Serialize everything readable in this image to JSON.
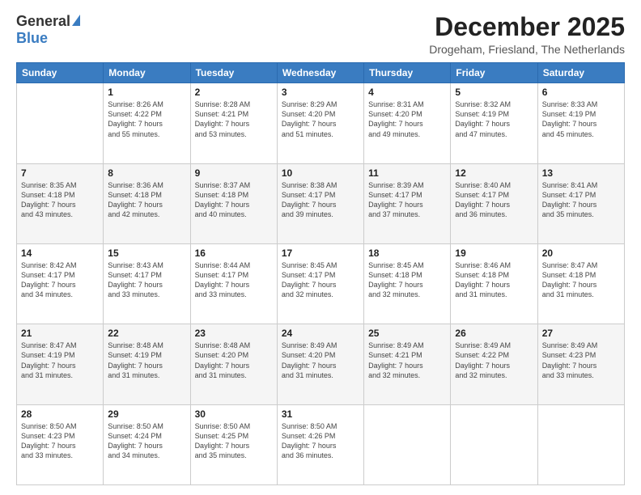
{
  "logo": {
    "general": "General",
    "blue": "Blue"
  },
  "title": "December 2025",
  "subtitle": "Drogeham, Friesland, The Netherlands",
  "days_of_week": [
    "Sunday",
    "Monday",
    "Tuesday",
    "Wednesday",
    "Thursday",
    "Friday",
    "Saturday"
  ],
  "weeks": [
    [
      {
        "day": "",
        "info": ""
      },
      {
        "day": "1",
        "info": "Sunrise: 8:26 AM\nSunset: 4:22 PM\nDaylight: 7 hours\nand 55 minutes."
      },
      {
        "day": "2",
        "info": "Sunrise: 8:28 AM\nSunset: 4:21 PM\nDaylight: 7 hours\nand 53 minutes."
      },
      {
        "day": "3",
        "info": "Sunrise: 8:29 AM\nSunset: 4:20 PM\nDaylight: 7 hours\nand 51 minutes."
      },
      {
        "day": "4",
        "info": "Sunrise: 8:31 AM\nSunset: 4:20 PM\nDaylight: 7 hours\nand 49 minutes."
      },
      {
        "day": "5",
        "info": "Sunrise: 8:32 AM\nSunset: 4:19 PM\nDaylight: 7 hours\nand 47 minutes."
      },
      {
        "day": "6",
        "info": "Sunrise: 8:33 AM\nSunset: 4:19 PM\nDaylight: 7 hours\nand 45 minutes."
      }
    ],
    [
      {
        "day": "7",
        "info": ""
      },
      {
        "day": "8",
        "info": "Sunrise: 8:36 AM\nSunset: 4:18 PM\nDaylight: 7 hours\nand 42 minutes."
      },
      {
        "day": "9",
        "info": "Sunrise: 8:37 AM\nSunset: 4:18 PM\nDaylight: 7 hours\nand 40 minutes."
      },
      {
        "day": "10",
        "info": "Sunrise: 8:38 AM\nSunset: 4:17 PM\nDaylight: 7 hours\nand 39 minutes."
      },
      {
        "day": "11",
        "info": "Sunrise: 8:39 AM\nSunset: 4:17 PM\nDaylight: 7 hours\nand 37 minutes."
      },
      {
        "day": "12",
        "info": "Sunrise: 8:40 AM\nSunset: 4:17 PM\nDaylight: 7 hours\nand 36 minutes."
      },
      {
        "day": "13",
        "info": "Sunrise: 8:41 AM\nSunset: 4:17 PM\nDaylight: 7 hours\nand 35 minutes."
      }
    ],
    [
      {
        "day": "14",
        "info": ""
      },
      {
        "day": "15",
        "info": "Sunrise: 8:43 AM\nSunset: 4:17 PM\nDaylight: 7 hours\nand 33 minutes."
      },
      {
        "day": "16",
        "info": "Sunrise: 8:44 AM\nSunset: 4:17 PM\nDaylight: 7 hours\nand 33 minutes."
      },
      {
        "day": "17",
        "info": "Sunrise: 8:45 AM\nSunset: 4:17 PM\nDaylight: 7 hours\nand 32 minutes."
      },
      {
        "day": "18",
        "info": "Sunrise: 8:45 AM\nSunset: 4:18 PM\nDaylight: 7 hours\nand 32 minutes."
      },
      {
        "day": "19",
        "info": "Sunrise: 8:46 AM\nSunset: 4:18 PM\nDaylight: 7 hours\nand 31 minutes."
      },
      {
        "day": "20",
        "info": "Sunrise: 8:47 AM\nSunset: 4:18 PM\nDaylight: 7 hours\nand 31 minutes."
      }
    ],
    [
      {
        "day": "21",
        "info": ""
      },
      {
        "day": "22",
        "info": "Sunrise: 8:48 AM\nSunset: 4:19 PM\nDaylight: 7 hours\nand 31 minutes."
      },
      {
        "day": "23",
        "info": "Sunrise: 8:48 AM\nSunset: 4:20 PM\nDaylight: 7 hours\nand 31 minutes."
      },
      {
        "day": "24",
        "info": "Sunrise: 8:49 AM\nSunset: 4:20 PM\nDaylight: 7 hours\nand 31 minutes."
      },
      {
        "day": "25",
        "info": "Sunrise: 8:49 AM\nSunset: 4:21 PM\nDaylight: 7 hours\nand 32 minutes."
      },
      {
        "day": "26",
        "info": "Sunrise: 8:49 AM\nSunset: 4:22 PM\nDaylight: 7 hours\nand 32 minutes."
      },
      {
        "day": "27",
        "info": "Sunrise: 8:49 AM\nSunset: 4:23 PM\nDaylight: 7 hours\nand 33 minutes."
      }
    ],
    [
      {
        "day": "28",
        "info": "Sunrise: 8:50 AM\nSunset: 4:23 PM\nDaylight: 7 hours\nand 33 minutes."
      },
      {
        "day": "29",
        "info": "Sunrise: 8:50 AM\nSunset: 4:24 PM\nDaylight: 7 hours\nand 34 minutes."
      },
      {
        "day": "30",
        "info": "Sunrise: 8:50 AM\nSunset: 4:25 PM\nDaylight: 7 hours\nand 35 minutes."
      },
      {
        "day": "31",
        "info": "Sunrise: 8:50 AM\nSunset: 4:26 PM\nDaylight: 7 hours\nand 36 minutes."
      },
      {
        "day": "",
        "info": ""
      },
      {
        "day": "",
        "info": ""
      },
      {
        "day": "",
        "info": ""
      }
    ]
  ],
  "week7_sunday": "Sunrise: 8:35 AM\nSunset: 4:18 PM\nDaylight: 7 hours\nand 43 minutes.",
  "week14_sunday": "Sunrise: 8:42 AM\nSunset: 4:17 PM\nDaylight: 7 hours\nand 34 minutes.",
  "week21_sunday": "Sunrise: 8:47 AM\nSunset: 4:19 PM\nDaylight: 7 hours\nand 31 minutes."
}
